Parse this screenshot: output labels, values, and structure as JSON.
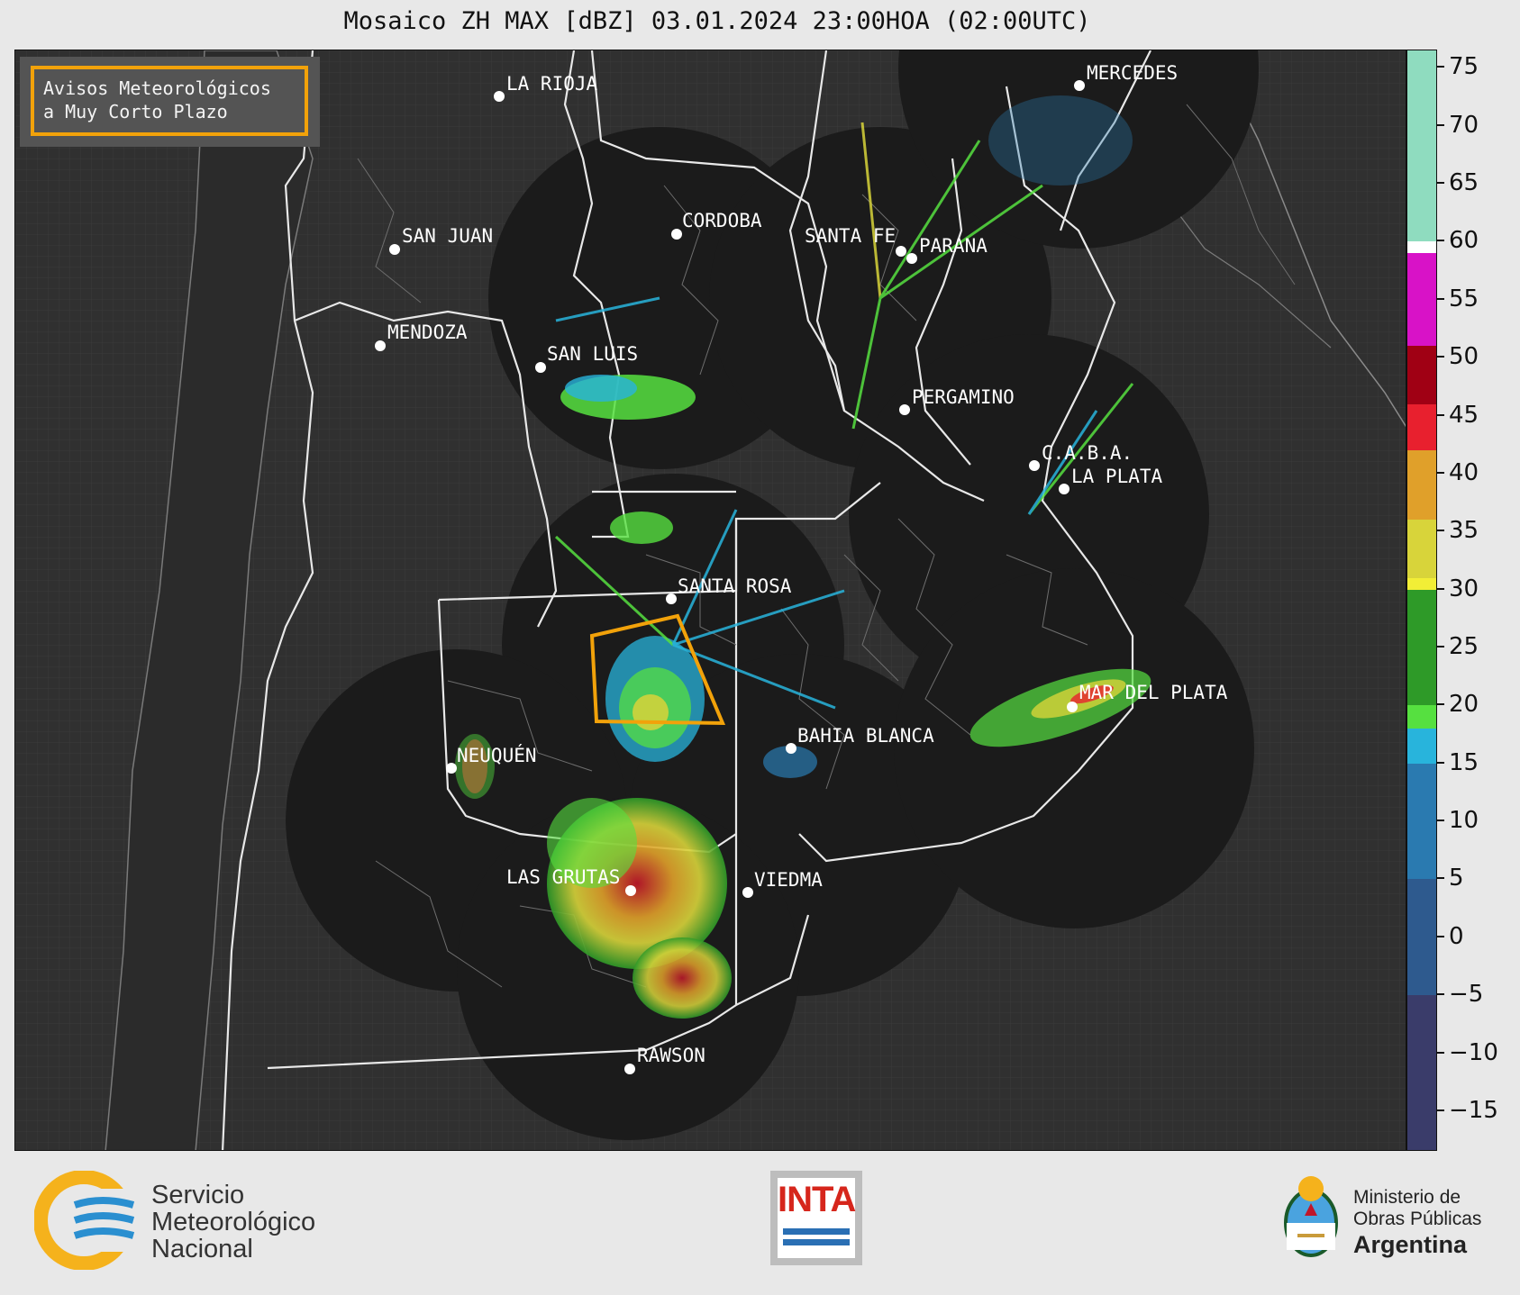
{
  "title": "Mosaico ZH MAX [dBZ] 03.01.2024 23:00HOA (02:00UTC)",
  "avisos": {
    "line1": "Avisos Meteorológicos",
    "line2": "a Muy Corto Plazo"
  },
  "cities": [
    {
      "name": "LA RIOJA"
    },
    {
      "name": "MERCEDES"
    },
    {
      "name": "CORDOBA"
    },
    {
      "name": "SAN JUAN"
    },
    {
      "name": "SANTA FE"
    },
    {
      "name": "PARANA"
    },
    {
      "name": "MENDOZA"
    },
    {
      "name": "SAN LUIS"
    },
    {
      "name": "PERGAMINO"
    },
    {
      "name": "C.A.B.A."
    },
    {
      "name": "LA PLATA"
    },
    {
      "name": "SANTA ROSA"
    },
    {
      "name": "MAR DEL PLATA"
    },
    {
      "name": "BAHIA BLANCA"
    },
    {
      "name": "NEUQUÉN"
    },
    {
      "name": "LAS GRUTAS"
    },
    {
      "name": "VIEDMA"
    },
    {
      "name": "RAWSON"
    }
  ],
  "colorbar": {
    "min": -18.5,
    "max": 76.5,
    "ticks": [
      "75",
      "70",
      "65",
      "60",
      "55",
      "50",
      "45",
      "40",
      "35",
      "30",
      "25",
      "20",
      "15",
      "10",
      "5",
      "0",
      "−5",
      "−10",
      "−15"
    ],
    "tick_values": [
      75,
      70,
      65,
      60,
      55,
      50,
      45,
      40,
      35,
      30,
      25,
      20,
      15,
      10,
      5,
      0,
      -5,
      -10,
      -15
    ],
    "bands": [
      {
        "from": 60,
        "to": 76.5,
        "color": "#8fdcbf"
      },
      {
        "from": 59,
        "to": 60,
        "color": "#ffffff"
      },
      {
        "from": 51,
        "to": 59,
        "color": "#d812c7"
      },
      {
        "from": 46,
        "to": 51,
        "color": "#a00014"
      },
      {
        "from": 42,
        "to": 46,
        "color": "#e8202e"
      },
      {
        "from": 36,
        "to": 42,
        "color": "#e0a02a"
      },
      {
        "from": 31,
        "to": 36,
        "color": "#d8d43a"
      },
      {
        "from": 30,
        "to": 31,
        "color": "#f2ee36"
      },
      {
        "from": 20,
        "to": 30,
        "color": "#2e9a28"
      },
      {
        "from": 18,
        "to": 20,
        "color": "#56e040"
      },
      {
        "from": 15,
        "to": 18,
        "color": "#28b4dc"
      },
      {
        "from": 5,
        "to": 15,
        "color": "#2a7ab0"
      },
      {
        "from": -5,
        "to": 5,
        "color": "#2e5a8e"
      },
      {
        "from": -18.5,
        "to": -5,
        "color": "#3a3c6a"
      }
    ]
  },
  "logos": {
    "smn_line1": "Servicio",
    "smn_line2": "Meteorológico",
    "smn_line3": "Nacional",
    "inta": "INTA",
    "min_line1": "Ministerio de",
    "min_line2": "Obras Públicas",
    "min_line3": "Argentina"
  }
}
